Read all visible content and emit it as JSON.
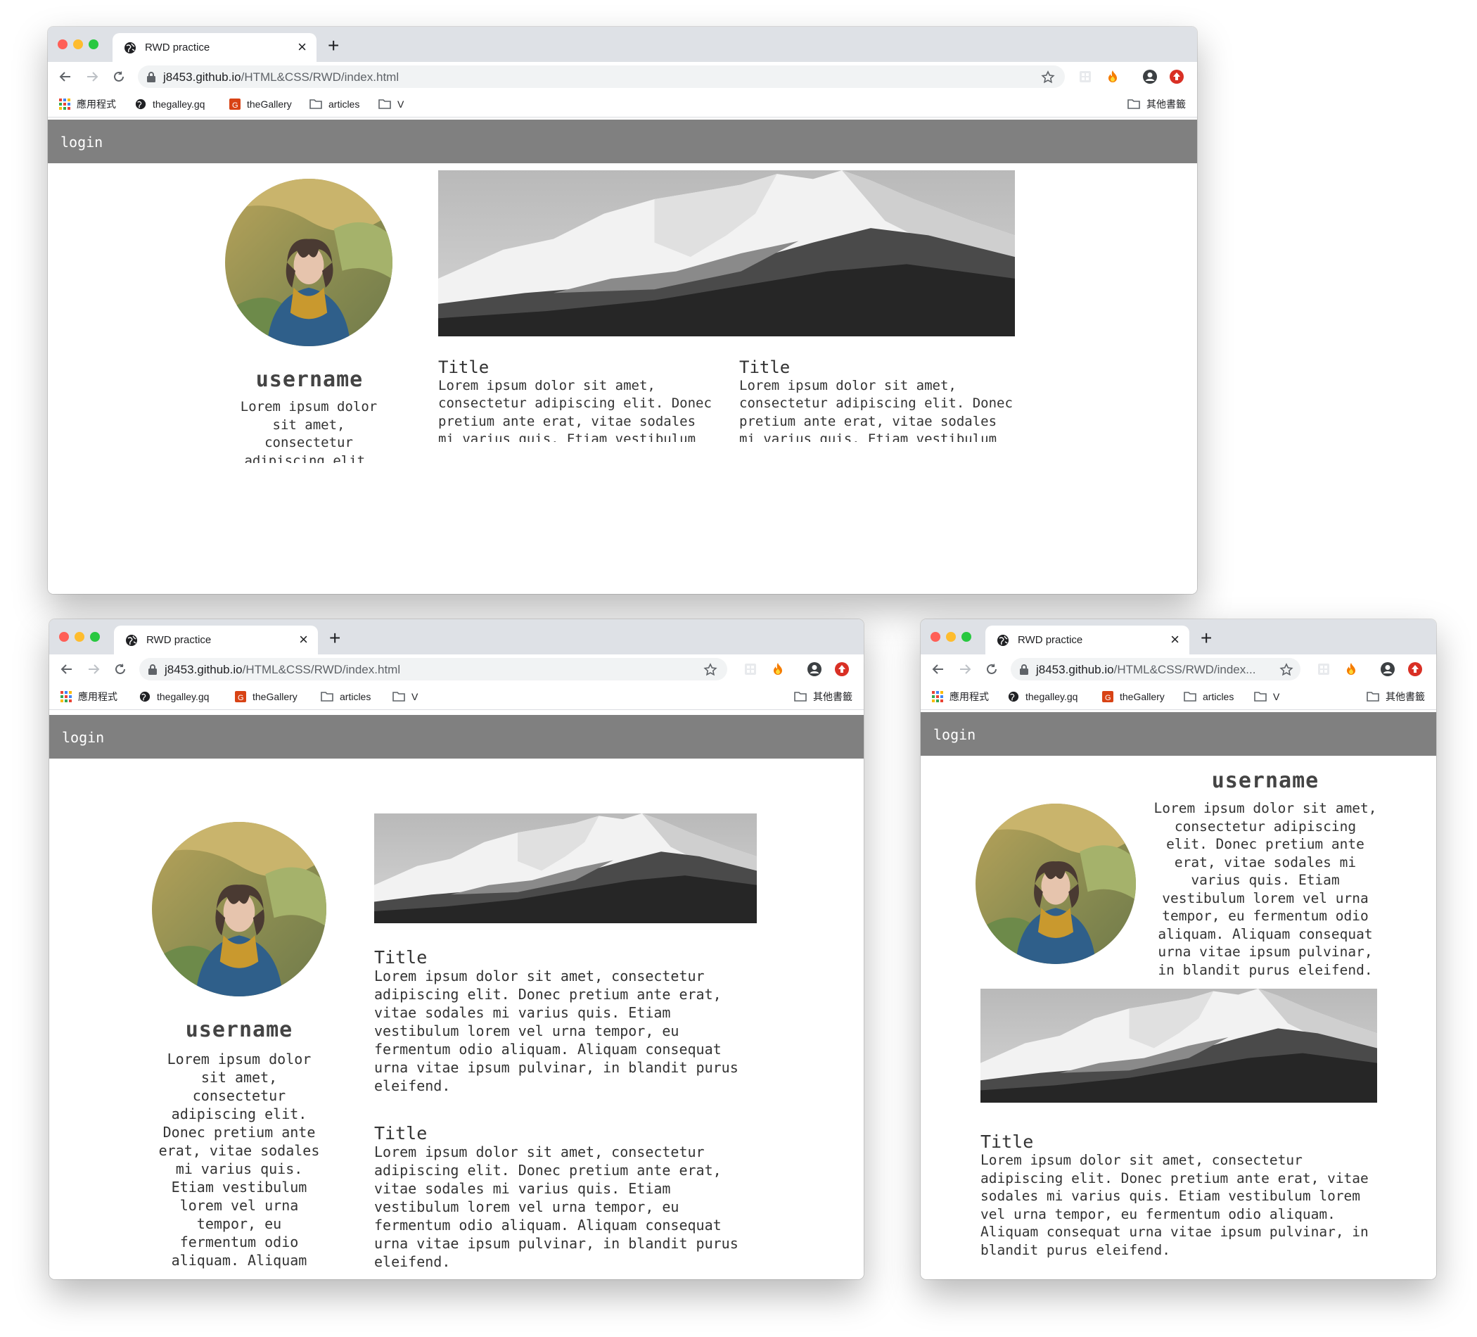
{
  "browser": {
    "tab_title": "RWD practice",
    "tab_close": "×",
    "new_tab": "+",
    "url_host": "j8453.github.io",
    "url_path": "/HTML&CSS/RWD/index.html",
    "url_path_truncated": "/HTML&CSS/RWD/index...",
    "bookmarks": [
      "應用程式",
      "thegalley.gq",
      "theGallery",
      "articles",
      "V"
    ],
    "other_bookmarks": "其他書籤",
    "theme": {
      "tabstrip": "#dee1e6",
      "omnibox": "#f1f3f4",
      "close": "#ff5f57",
      "minimize": "#febc2e",
      "zoom": "#28c840"
    }
  },
  "site": {
    "header_bg": "#808080",
    "login_label": "login",
    "username": "username",
    "bio": "Lorem ipsum dolor sit amet, consectetur adipiscing elit. Donec pretium ante erat, vitae sodales mi varius quis. Etiam vestibulum lorem vel urna tempor, eu fermentum odio aliquam. Aliquam consequat urna vitae ipsum pulvinar, in blandit purus eleifend.",
    "cards": [
      {
        "title": "Title",
        "body": "Lorem ipsum dolor sit amet, consectetur adipiscing elit. Donec pretium ante erat, vitae sodales mi varius quis. Etiam vestibulum lorem vel urna tempor, eu fermentum odio aliquam. Aliquam consequat urna vitae ipsum pulvinar, in blandit purus eleifend."
      },
      {
        "title": "Title",
        "body": "Lorem ipsum dolor sit amet, consectetur adipiscing elit. Donec pretium ante erat, vitae sodales mi varius quis. Etiam vestibulum lorem vel urna tempor, eu fermentum odio aliquam. Aliquam consequat urna vitae ipsum pulvinar, in blandit purus eleifend."
      }
    ]
  }
}
